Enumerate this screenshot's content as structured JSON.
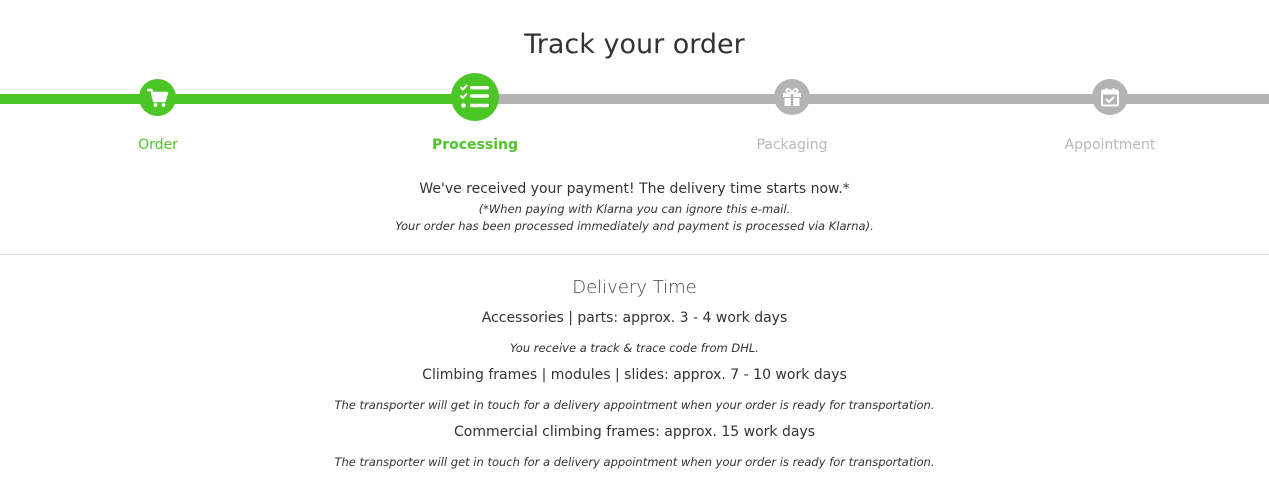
{
  "title": "Track your order",
  "colors": {
    "active": "#4cc626",
    "inactive": "#b3b3b3",
    "inactive_text": "#b8b8b8"
  },
  "steps": [
    {
      "label": "Order",
      "icon": "cart-icon",
      "state": "done"
    },
    {
      "label": "Processing",
      "icon": "checklist-icon",
      "state": "current"
    },
    {
      "label": "Packaging",
      "icon": "gift-icon",
      "state": "todo"
    },
    {
      "label": "Appointment",
      "icon": "calendar-check-icon",
      "state": "todo"
    }
  ],
  "status": {
    "lead": "We've received your payment! The delivery time starts now.*",
    "note_1": "(*When paying with Klarna you can ignore this e-mail.",
    "note_2": "Your order has been processed immediately and payment is processed via Klarna)."
  },
  "delivery": {
    "title": "Delivery Time",
    "items": [
      {
        "line": "Accessories | parts: approx. 3 - 4 work days",
        "note": "You receive a track & trace code from DHL."
      },
      {
        "line": "Climbing frames | modules | slides: approx. 7 - 10 work days",
        "note": "The transporter will get in touch for a delivery appointment when your order is ready for transportation."
      },
      {
        "line": "Commercial climbing frames: approx. 15 work days",
        "note": "The transporter will get in touch for a delivery appointment when your order is ready for transportation."
      }
    ]
  }
}
